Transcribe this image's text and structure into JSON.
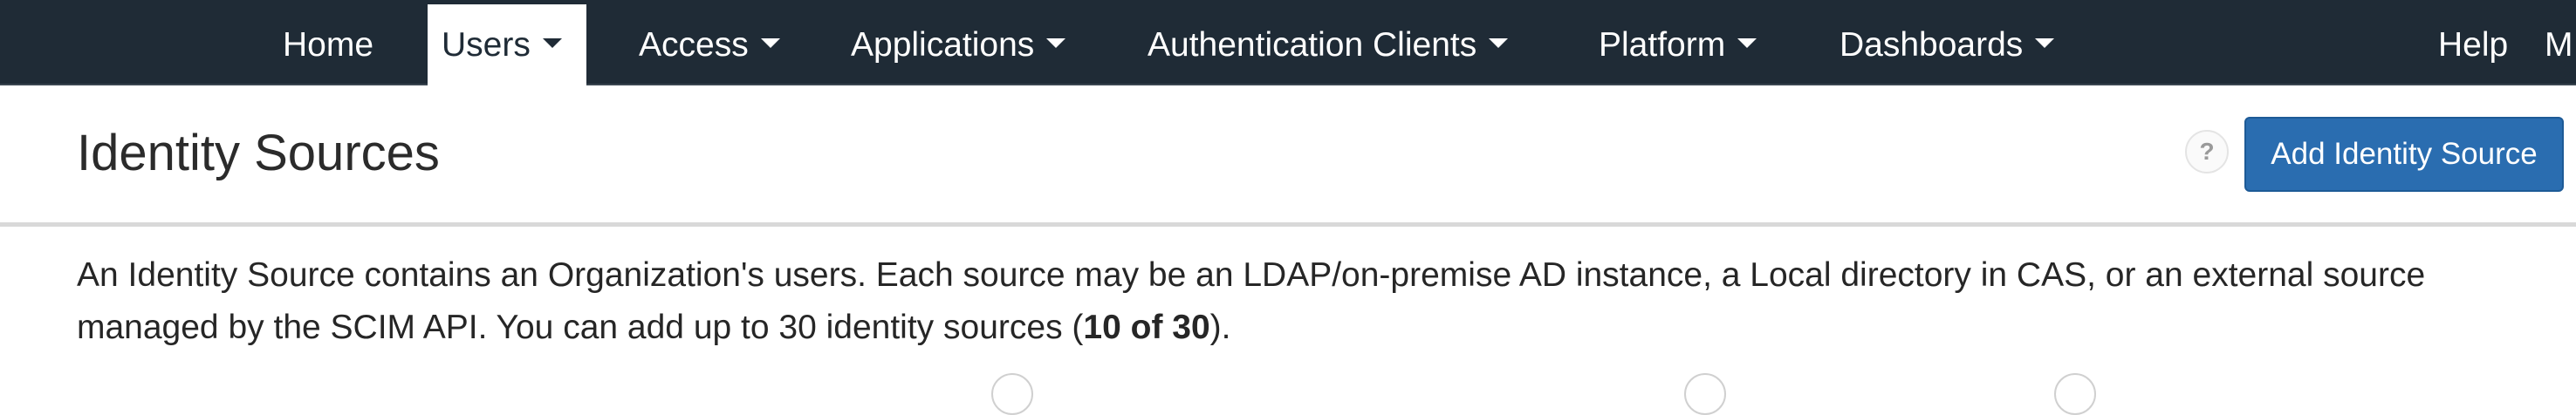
{
  "nav": {
    "items": [
      {
        "label": "Home",
        "has_dropdown": false,
        "active": false
      },
      {
        "label": "Users",
        "has_dropdown": true,
        "active": true
      },
      {
        "label": "Access",
        "has_dropdown": true,
        "active": false
      },
      {
        "label": "Applications",
        "has_dropdown": true,
        "active": false
      },
      {
        "label": "Authentication Clients",
        "has_dropdown": true,
        "active": false
      },
      {
        "label": "Platform",
        "has_dropdown": true,
        "active": false
      },
      {
        "label": "Dashboards",
        "has_dropdown": true,
        "active": false
      }
    ],
    "help_label": "Help",
    "user_label": "M"
  },
  "header": {
    "title": "Identity Sources",
    "help_icon": "question-icon",
    "help_glyph": "?",
    "add_button_label": "Add Identity Source"
  },
  "description": {
    "text_before": "An Identity Source contains an Organization's users. Each source may be an LDAP/on-premise AD instance, a Local directory in CAS, or an external source managed by the SCIM API. You can add up to 30 identity sources (",
    "count": "10 of 30",
    "text_after": ")."
  },
  "colors": {
    "nav_background": "#1f2b36",
    "primary_button": "#2a6db0",
    "divider": "#d9d9d9"
  }
}
